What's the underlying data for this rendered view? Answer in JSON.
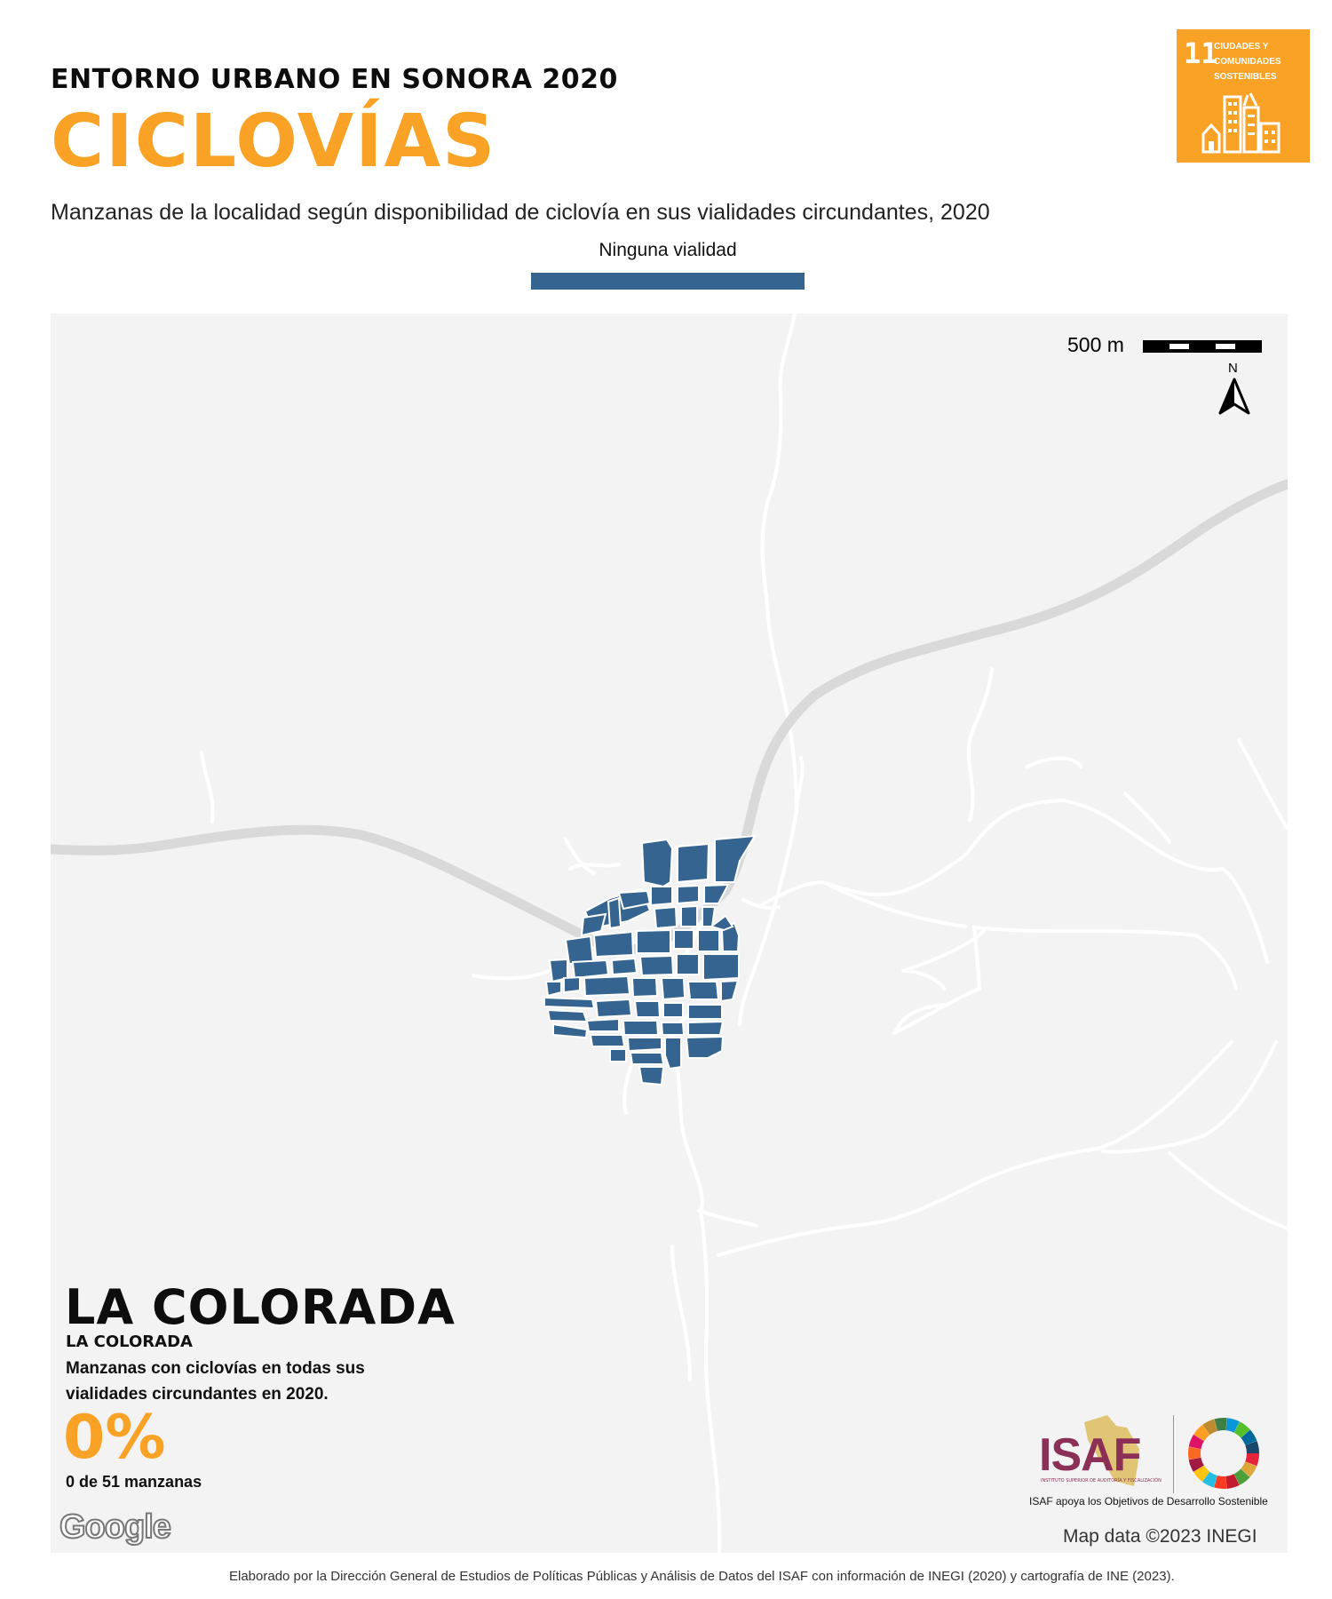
{
  "header": {
    "supertitle": "ENTORNO URBANO EN SONORA 2020",
    "title": "CICLOVÍAS",
    "subtitle": "Manzanas de la localidad según disponibilidad de ciclovía en sus vialidades circundantes, 2020"
  },
  "legend": {
    "label": "Ninguna vialidad",
    "color": "#34648f"
  },
  "sdg_badge": {
    "number": "11",
    "text": "CIUDADES Y COMUNIDADES SOSTENIBLES",
    "color": "#f9a225",
    "icon": "city-buildings-icon"
  },
  "map": {
    "scale_label": "500 m",
    "north_label": "N",
    "attribution": "Map data ©2023 INEGI",
    "google_logo": "Google",
    "background_color": "#f3f3f3",
    "block_color": "#34648f"
  },
  "locality": {
    "name": "LA COLORADA",
    "subname": "LA COLORADA",
    "description": "Manzanas con ciclovías en todas sus vialidades circundantes en 2020.",
    "percent": "0%",
    "count_text": "0 de 51 manzanas"
  },
  "logos": {
    "isaf_text": "ISAF",
    "isaf_fine_print": "INSTITUTO SUPERIOR DE AUDITORÍA Y FISCALIZACIÓN",
    "isaf_caption": "ISAF apoya los Objetivos de Desarrollo Sostenible"
  },
  "footer": {
    "source": "Elaborado por la Dirección General de Estudios de Políticas Públicas y Análisis de Datos del ISAF con información de INEGI (2020) y cartografía de INE (2023)."
  }
}
